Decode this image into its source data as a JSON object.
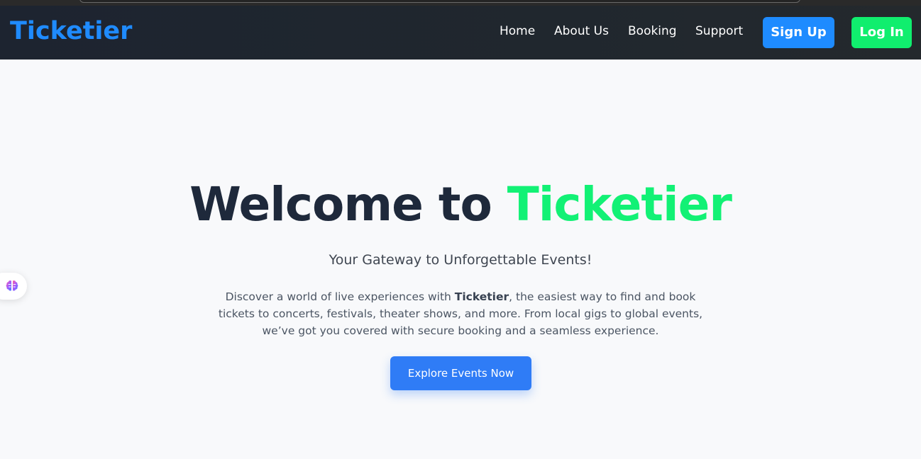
{
  "brand": {
    "name": "Ticketier",
    "color": "#1f8bff"
  },
  "nav": {
    "links": [
      {
        "label": "Home"
      },
      {
        "label": "About Us"
      },
      {
        "label": "Booking"
      },
      {
        "label": "Support"
      }
    ],
    "signup_label": "Sign Up",
    "login_label": "Log In",
    "signup_color": "#1e8bff",
    "login_color": "#10ee6e"
  },
  "hero": {
    "title_prefix": "Welcome to",
    "title_accent": "Ticketier",
    "accent_color": "#12f175",
    "subtitle": "Your Gateway to Unforgettable Events!",
    "desc_before": "Discover a world of live experiences with ",
    "desc_bold": "Ticketier",
    "desc_after": ", the easiest way to find and book tickets to concerts, festivals, theater shows, and more. From local gigs to global events, we’ve got you covered with secure booking and a seamless experience.",
    "cta_label": "Explore Events Now",
    "cta_color": "#2f7cf6"
  },
  "widget": {
    "icon": "brain-icon"
  }
}
